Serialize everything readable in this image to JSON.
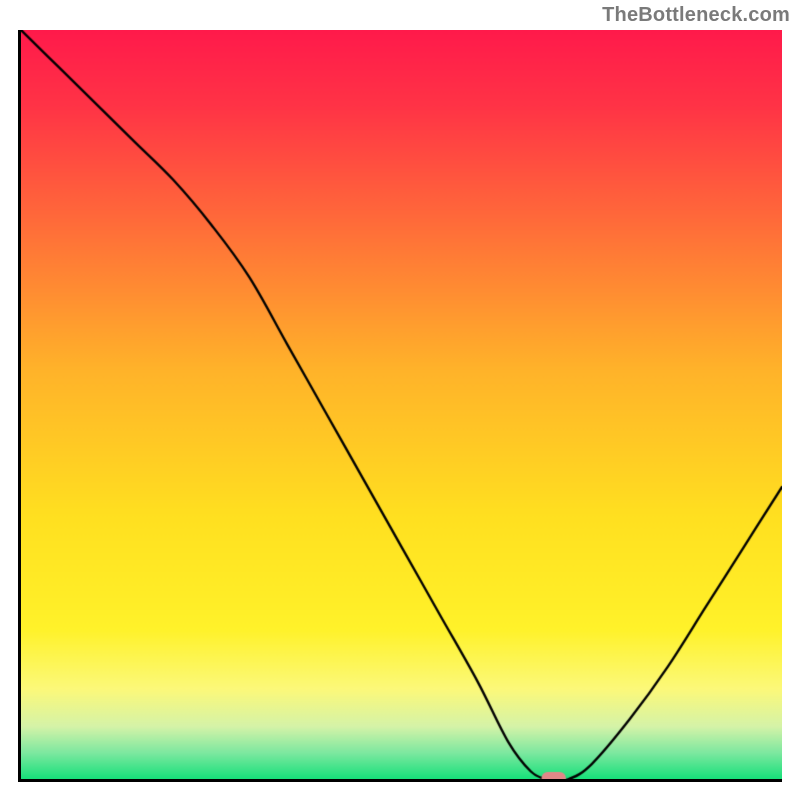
{
  "watermark": "TheBottleneck.com",
  "chart_data": {
    "type": "line",
    "title": "",
    "xlabel": "",
    "ylabel": "",
    "xlim": [
      0,
      100
    ],
    "ylim": [
      0,
      100
    ],
    "series": [
      {
        "name": "curve",
        "x": [
          0,
          5,
          10,
          15,
          20,
          25,
          30,
          35,
          40,
          45,
          50,
          55,
          60,
          64,
          67,
          69,
          70,
          72,
          75,
          80,
          85,
          90,
          95,
          100
        ],
        "values": [
          100,
          95,
          90,
          85,
          80,
          74,
          67,
          58,
          49,
          40,
          31,
          22,
          13,
          5,
          1,
          0,
          0,
          0,
          2,
          8,
          15,
          23,
          31,
          39
        ]
      }
    ],
    "marker": {
      "x": 70,
      "y": 0,
      "color": "#e08888",
      "w": 3.2,
      "h": 1.6
    },
    "gradient_stops": [
      {
        "pos": 0.0,
        "color": "#ff1a4b"
      },
      {
        "pos": 0.1,
        "color": "#ff3346"
      },
      {
        "pos": 0.25,
        "color": "#ff693a"
      },
      {
        "pos": 0.45,
        "color": "#ffb22a"
      },
      {
        "pos": 0.65,
        "color": "#ffe020"
      },
      {
        "pos": 0.8,
        "color": "#fff22a"
      },
      {
        "pos": 0.88,
        "color": "#fcf97a"
      },
      {
        "pos": 0.93,
        "color": "#d5f3a8"
      },
      {
        "pos": 0.965,
        "color": "#7de8a0"
      },
      {
        "pos": 1.0,
        "color": "#17e07a"
      }
    ]
  }
}
